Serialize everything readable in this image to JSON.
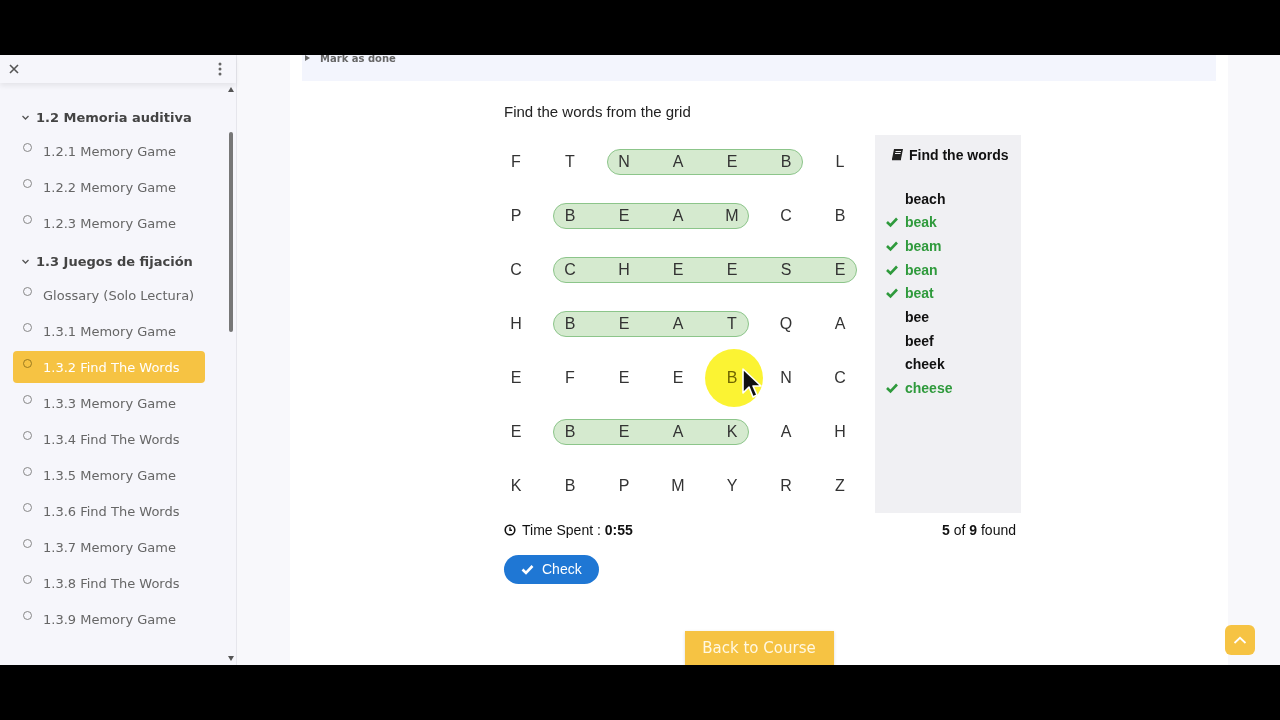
{
  "sidebar": {
    "items": [
      {
        "label": "1.2 Memoria auditiva",
        "expanded": true,
        "children": [
          {
            "label": "1.2.1 Memory Game",
            "selected": false
          },
          {
            "label": "1.2.2 Memory Game",
            "selected": false
          },
          {
            "label": "1.2.3 Memory Game",
            "selected": false
          }
        ]
      },
      {
        "label": "1.3 Juegos de fijación",
        "expanded": true,
        "children": [
          {
            "label": "Glossary (Solo Lectura)",
            "selected": false
          },
          {
            "label": "1.3.1 Memory Game",
            "selected": false
          },
          {
            "label": "1.3.2 Find The Words",
            "selected": true
          },
          {
            "label": "1.3.3 Memory Game",
            "selected": false
          },
          {
            "label": "1.3.4 Find The Words",
            "selected": false
          },
          {
            "label": "1.3.5 Memory Game",
            "selected": false
          },
          {
            "label": "1.3.6 Find The Words",
            "selected": false
          },
          {
            "label": "1.3.7 Memory Game",
            "selected": false
          },
          {
            "label": "1.3.8 Find The Words",
            "selected": false
          },
          {
            "label": "1.3.9 Memory Game",
            "selected": false
          }
        ]
      }
    ]
  },
  "mark_done": {
    "label": "Mark as done"
  },
  "game": {
    "instruction": "Find the words from the grid",
    "grid": [
      [
        {
          "letter": "F",
          "marked": false,
          "pointer": false
        },
        {
          "letter": "T",
          "marked": false,
          "pointer": false
        },
        {
          "letter": "N",
          "marked": true,
          "pointer": false
        },
        {
          "letter": "A",
          "marked": true,
          "pointer": false
        },
        {
          "letter": "E",
          "marked": true,
          "pointer": false
        },
        {
          "letter": "B",
          "marked": true,
          "pointer": false
        },
        {
          "letter": "L",
          "marked": false,
          "pointer": false
        }
      ],
      [
        {
          "letter": "P",
          "marked": false,
          "pointer": false
        },
        {
          "letter": "B",
          "marked": true,
          "pointer": false
        },
        {
          "letter": "E",
          "marked": true,
          "pointer": false
        },
        {
          "letter": "A",
          "marked": true,
          "pointer": false
        },
        {
          "letter": "M",
          "marked": true,
          "pointer": false
        },
        {
          "letter": "C",
          "marked": false,
          "pointer": false
        },
        {
          "letter": "B",
          "marked": false,
          "pointer": false
        }
      ],
      [
        {
          "letter": "C",
          "marked": false,
          "pointer": false
        },
        {
          "letter": "C",
          "marked": true,
          "pointer": false
        },
        {
          "letter": "H",
          "marked": true,
          "pointer": false
        },
        {
          "letter": "E",
          "marked": true,
          "pointer": false
        },
        {
          "letter": "E",
          "marked": true,
          "pointer": false
        },
        {
          "letter": "S",
          "marked": true,
          "pointer": false
        },
        {
          "letter": "E",
          "marked": true,
          "pointer": false
        }
      ],
      [
        {
          "letter": "H",
          "marked": false,
          "pointer": false
        },
        {
          "letter": "B",
          "marked": true,
          "pointer": false
        },
        {
          "letter": "E",
          "marked": true,
          "pointer": false
        },
        {
          "letter": "A",
          "marked": true,
          "pointer": false
        },
        {
          "letter": "T",
          "marked": true,
          "pointer": false
        },
        {
          "letter": "Q",
          "marked": false,
          "pointer": false
        },
        {
          "letter": "A",
          "marked": false,
          "pointer": false
        }
      ],
      [
        {
          "letter": "E",
          "marked": false,
          "pointer": false
        },
        {
          "letter": "F",
          "marked": false,
          "pointer": false
        },
        {
          "letter": "E",
          "marked": false,
          "pointer": false
        },
        {
          "letter": "E",
          "marked": false,
          "pointer": false
        },
        {
          "letter": "B",
          "marked": false,
          "pointer": true
        },
        {
          "letter": "N",
          "marked": false,
          "pointer": false
        },
        {
          "letter": "C",
          "marked": false,
          "pointer": false
        }
      ],
      [
        {
          "letter": "E",
          "marked": false,
          "pointer": false
        },
        {
          "letter": "B",
          "marked": true,
          "pointer": false
        },
        {
          "letter": "E",
          "marked": true,
          "pointer": false
        },
        {
          "letter": "A",
          "marked": true,
          "pointer": false
        },
        {
          "letter": "K",
          "marked": true,
          "pointer": false
        },
        {
          "letter": "A",
          "marked": false,
          "pointer": false
        },
        {
          "letter": "H",
          "marked": false,
          "pointer": false
        }
      ],
      [
        {
          "letter": "K",
          "marked": false,
          "pointer": false
        },
        {
          "letter": "B",
          "marked": false,
          "pointer": false
        },
        {
          "letter": "P",
          "marked": false,
          "pointer": false
        },
        {
          "letter": "M",
          "marked": false,
          "pointer": false
        },
        {
          "letter": "Y",
          "marked": false,
          "pointer": false
        },
        {
          "letter": "R",
          "marked": false,
          "pointer": false
        },
        {
          "letter": "Z",
          "marked": false,
          "pointer": false
        }
      ]
    ],
    "word_list": {
      "title": "Find the words",
      "words": [
        {
          "word": "beach",
          "found": false
        },
        {
          "word": "beak",
          "found": true
        },
        {
          "word": "beam",
          "found": true
        },
        {
          "word": "bean",
          "found": true
        },
        {
          "word": "beat",
          "found": true
        },
        {
          "word": "bee",
          "found": false
        },
        {
          "word": "beef",
          "found": false
        },
        {
          "word": "cheek",
          "found": false
        },
        {
          "word": "cheese",
          "found": true
        }
      ]
    },
    "time_label": "Time Spent : **0:55**",
    "progress": "**5** of **9** found",
    "check_button": "Check"
  },
  "back_button": "Back to Course"
}
